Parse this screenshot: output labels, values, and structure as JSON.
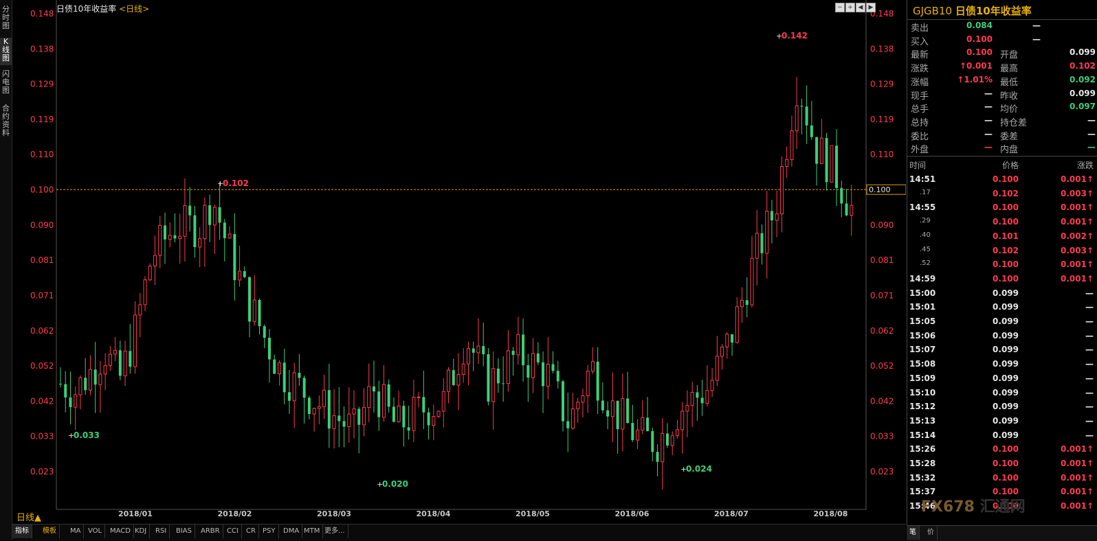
{
  "left_tabs": [
    "分时图",
    "K线图",
    "闪电图",
    "合约资料"
  ],
  "chart": {
    "title": "日债10年收益率",
    "timeframe_tag": "<日线>",
    "period_label": "日线▲",
    "y_ticks": [
      "0.148",
      "0.138",
      "0.129",
      "0.119",
      "0.110",
      "0.100",
      "0.090",
      "0.081",
      "0.071",
      "0.062",
      "0.052",
      "0.042",
      "0.033",
      "0.023"
    ],
    "x_ticks": [
      "2018/01",
      "2018/02",
      "2018/03",
      "2018/04",
      "2018/05",
      "2018/06",
      "2018/07",
      "2018/08"
    ],
    "current_price_label": "0.100",
    "annotations": [
      {
        "text": "0.033",
        "color": "#3ad07a"
      },
      {
        "text": "0.102",
        "color": "#ff3b4e"
      },
      {
        "text": "0.020",
        "color": "#3ad07a"
      },
      {
        "text": "0.024",
        "color": "#3ad07a"
      },
      {
        "text": "0.142",
        "color": "#ff3b4e"
      }
    ],
    "up_color": "#ff3b4e",
    "down_color": "#3ad07a"
  },
  "bottom_tabs": [
    "指标",
    "模板",
    "MA",
    "VOL",
    "MACD",
    "KDJ",
    "RSI",
    "BIAS",
    "ARBR",
    "CCI",
    "CR",
    "PSY",
    "DMA",
    "MTM",
    "更多..."
  ],
  "panel": {
    "code": "GJGB10",
    "name": "日债10年收益率",
    "quote": [
      {
        "l1": "卖出",
        "v1": "0.084",
        "c1": "green",
        "l2": "",
        "v2": "—",
        "c2": "white"
      },
      {
        "l1": "买入",
        "v1": "0.100",
        "c1": "red",
        "l2": "",
        "v2": "—",
        "c2": "white"
      },
      {
        "l1": "最新",
        "v1": "0.100",
        "c1": "red",
        "l2": "开盘",
        "v2": "0.099",
        "c2": "white"
      },
      {
        "l1": "涨跌",
        "v1": "↑0.001",
        "c1": "red",
        "l2": "最高",
        "v2": "0.102",
        "c2": "red"
      },
      {
        "l1": "涨幅",
        "v1": "↑1.01%",
        "c1": "red",
        "l2": "最低",
        "v2": "0.092",
        "c2": "green"
      },
      {
        "l1": "现手",
        "v1": "—",
        "c1": "white",
        "l2": "昨收",
        "v2": "0.099",
        "c2": "white"
      },
      {
        "l1": "总手",
        "v1": "—",
        "c1": "white",
        "l2": "均价",
        "v2": "0.097",
        "c2": "green"
      },
      {
        "l1": "总持",
        "v1": "—",
        "c1": "white",
        "l2": "持仓差",
        "v2": "—",
        "c2": "white"
      },
      {
        "l1": "委比",
        "v1": "—",
        "c1": "white",
        "l2": "委差",
        "v2": "—",
        "c2": "white"
      },
      {
        "l1": "外盘",
        "v1": "—",
        "c1": "red",
        "l2": "内盘",
        "v2": "—",
        "c2": "green"
      }
    ],
    "ticks_header": {
      "time": "时间",
      "price": "价格",
      "change": "涨跌"
    },
    "ticks": [
      {
        "time": "14:51",
        "price": "0.100",
        "change": "0.001↑",
        "dir": "up"
      },
      {
        "time": ".17",
        "price": "0.102",
        "change": "0.003↑",
        "dir": "up",
        "sub": true
      },
      {
        "time": "14:55",
        "price": "0.100",
        "change": "0.001↑",
        "dir": "up"
      },
      {
        "time": ".29",
        "price": "0.100",
        "change": "0.001↑",
        "dir": "up",
        "sub": true
      },
      {
        "time": ".40",
        "price": "0.101",
        "change": "0.002↑",
        "dir": "up",
        "sub": true
      },
      {
        "time": ".45",
        "price": "0.102",
        "change": "0.003↑",
        "dir": "up",
        "sub": true
      },
      {
        "time": ".52",
        "price": "0.100",
        "change": "0.001↑",
        "dir": "up",
        "sub": true
      },
      {
        "time": "14:59",
        "price": "0.100",
        "change": "0.001↑",
        "dir": "up"
      },
      {
        "time": "15:00",
        "price": "0.099",
        "change": "—",
        "dir": "flat"
      },
      {
        "time": "15:01",
        "price": "0.099",
        "change": "—",
        "dir": "flat"
      },
      {
        "time": "15:05",
        "price": "0.099",
        "change": "—",
        "dir": "flat"
      },
      {
        "time": "15:06",
        "price": "0.099",
        "change": "—",
        "dir": "flat"
      },
      {
        "time": "15:07",
        "price": "0.099",
        "change": "—",
        "dir": "flat"
      },
      {
        "time": "15:08",
        "price": "0.099",
        "change": "—",
        "dir": "flat"
      },
      {
        "time": "15:09",
        "price": "0.099",
        "change": "—",
        "dir": "flat"
      },
      {
        "time": "15:10",
        "price": "0.099",
        "change": "—",
        "dir": "flat"
      },
      {
        "time": "15:12",
        "price": "0.099",
        "change": "—",
        "dir": "flat"
      },
      {
        "time": "15:13",
        "price": "0.099",
        "change": "—",
        "dir": "flat"
      },
      {
        "time": "15:14",
        "price": "0.099",
        "change": "—",
        "dir": "flat"
      },
      {
        "time": "15:26",
        "price": "0.100",
        "change": "0.001↑",
        "dir": "up"
      },
      {
        "time": "15:28",
        "price": "0.100",
        "change": "0.001↑",
        "dir": "up"
      },
      {
        "time": "15:32",
        "price": "0.100",
        "change": "0.001↑",
        "dir": "up"
      },
      {
        "time": "15:37",
        "price": "0.100",
        "change": "0.001↑",
        "dir": "up"
      },
      {
        "time": "15:46",
        "price": "0.100",
        "change": "0.001↑",
        "dir": "up"
      }
    ],
    "bottom_tabs": [
      "笔",
      "价"
    ],
    "watermark": "FX678 汇通网"
  }
}
